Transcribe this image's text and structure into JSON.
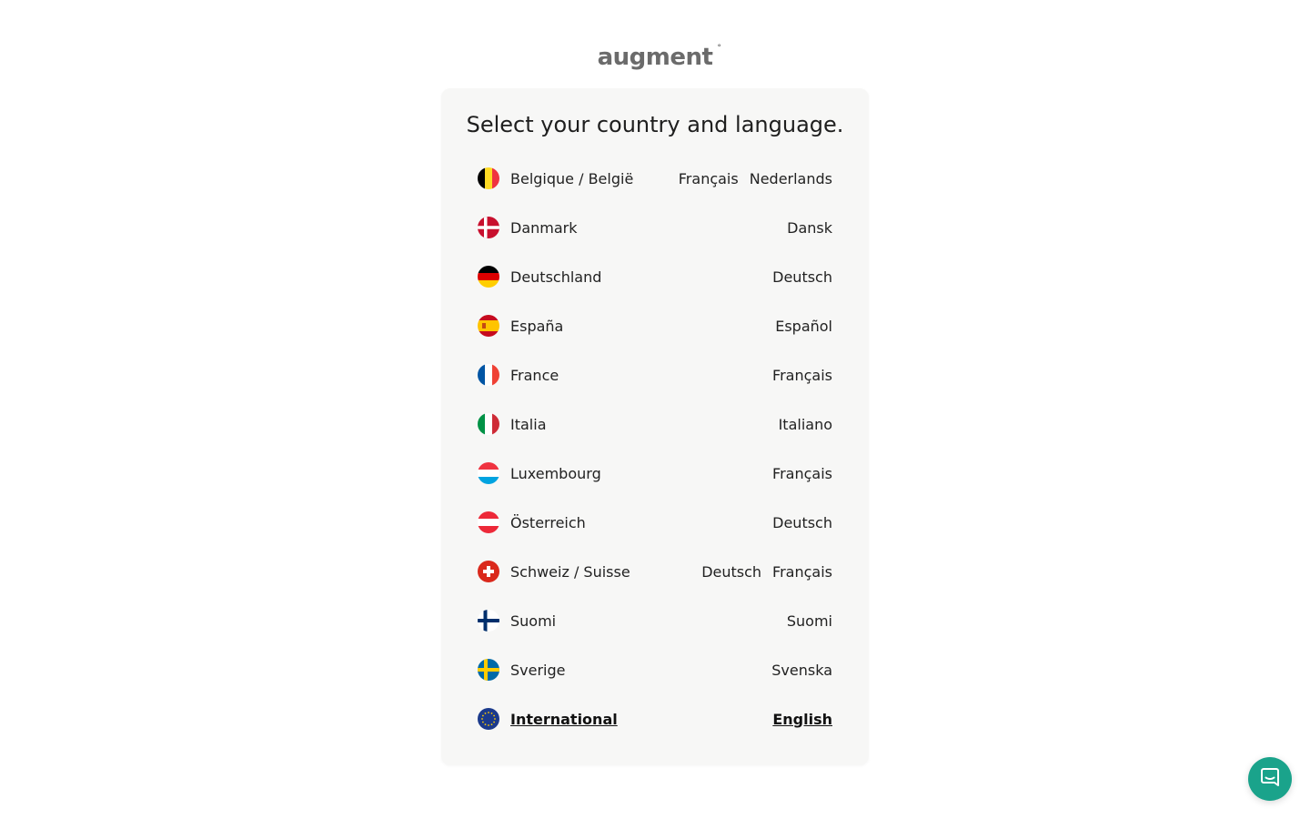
{
  "logo": {
    "text": "augment",
    "mark": "°"
  },
  "title": "Select your country and language.",
  "countries": [
    {
      "name": "Belgique / België",
      "flag": "belgium-flag-icon",
      "languages": [
        "Français",
        "Nederlands"
      ]
    },
    {
      "name": "Danmark",
      "flag": "denmark-flag-icon",
      "languages": [
        "Dansk"
      ]
    },
    {
      "name": "Deutschland",
      "flag": "germany-flag-icon",
      "languages": [
        "Deutsch"
      ]
    },
    {
      "name": "España",
      "flag": "spain-flag-icon",
      "languages": [
        "Español"
      ]
    },
    {
      "name": "France",
      "flag": "france-flag-icon",
      "languages": [
        "Français"
      ]
    },
    {
      "name": "Italia",
      "flag": "italy-flag-icon",
      "languages": [
        "Italiano"
      ]
    },
    {
      "name": "Luxembourg",
      "flag": "luxembourg-flag-icon",
      "languages": [
        "Français"
      ]
    },
    {
      "name": "Österreich",
      "flag": "austria-flag-icon",
      "languages": [
        "Deutsch"
      ]
    },
    {
      "name": "Schweiz / Suisse",
      "flag": "switzerland-flag-icon",
      "languages": [
        "Deutsch",
        "Français"
      ]
    },
    {
      "name": "Suomi",
      "flag": "finland-flag-icon",
      "languages": [
        "Suomi"
      ]
    },
    {
      "name": "Sverige",
      "flag": "sweden-flag-icon",
      "languages": [
        "Svenska"
      ]
    },
    {
      "name": "International",
      "flag": "eu-flag-icon",
      "languages": [
        "English"
      ],
      "selected": true
    }
  ],
  "chat": {
    "icon": "chat-icon"
  },
  "colors": {
    "accent": "#1aa38b",
    "card_bg": "#f7f7f6",
    "logo": "#6b6b6b"
  }
}
